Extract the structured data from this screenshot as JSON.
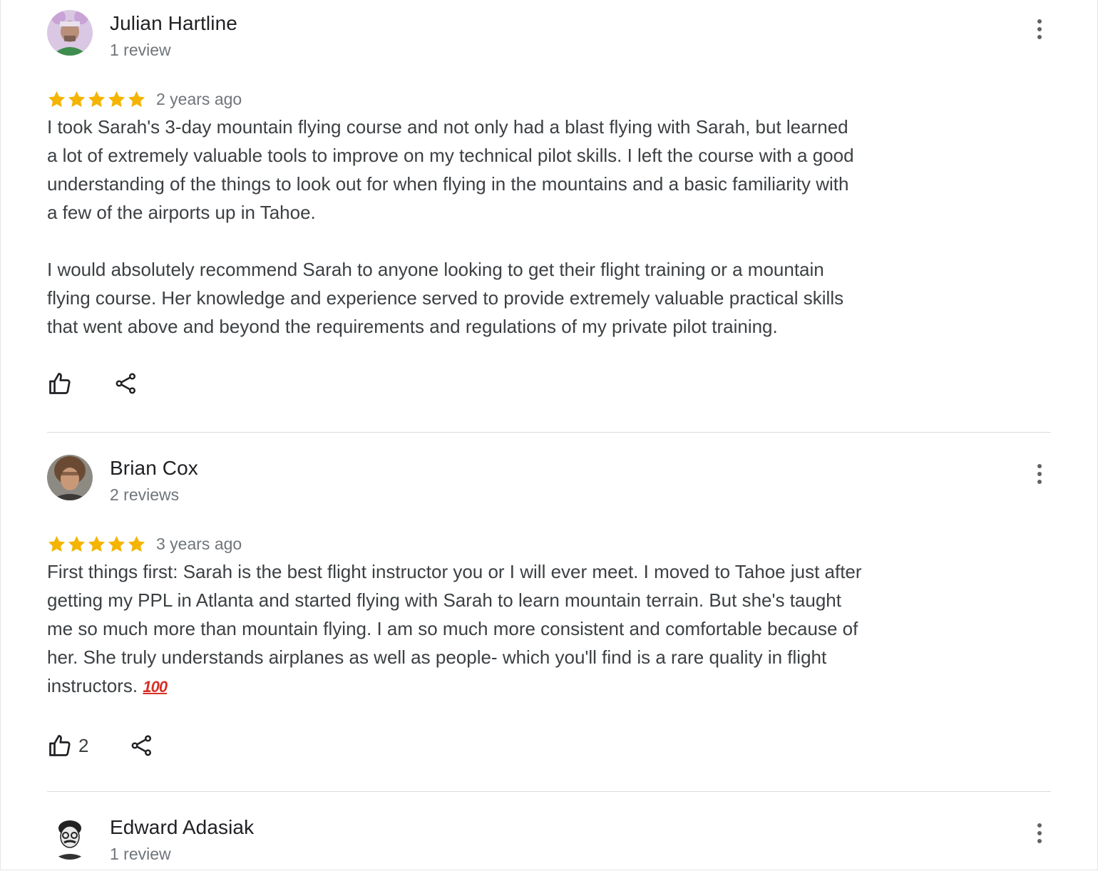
{
  "reviews": [
    {
      "name": "Julian Hartline",
      "review_count": "1 review",
      "rating": 5,
      "date": "2 years ago",
      "body": "I took Sarah's 3-day mountain flying course and not only had a blast flying with Sarah, but learned\na lot of extremely valuable tools to improve on my technical pilot skills. I left the course with a good\nunderstanding of the things to look out for when flying in the mountains and a basic familiarity with\na few of the airports up in Tahoe.\n\nI would absolutely recommend Sarah to anyone looking to get their flight training or a mountain\nflying course. Her knowledge and experience served to provide extremely valuable practical skills\nthat went above and beyond the requirements and regulations of my private pilot training.",
      "likes": ""
    },
    {
      "name": "Brian Cox",
      "review_count": "2 reviews",
      "rating": 5,
      "date": "3 years ago",
      "body": "First things first: Sarah is the best flight instructor you or I will ever meet. I moved to Tahoe just after\ngetting my PPL in Atlanta and started flying with Sarah to learn mountain terrain. But she's taught\nme so much more than mountain flying. I am so much more consistent and comfortable because of\nher. She truly understands airplanes as well as people- which you'll find is a rare quality in flight\ninstructors. ",
      "body_emoji": "100",
      "likes": "2"
    },
    {
      "name": "Edward Adasiak",
      "review_count": "1 review"
    }
  ],
  "colors": {
    "star": "#f4b400",
    "name": "#202124",
    "meta": "#70757a",
    "text": "#3c4043",
    "divider": "#dadce0"
  },
  "icons": {
    "more": "more-vert-icon",
    "like": "thumb-up-icon",
    "share": "share-icon",
    "star": "star-icon",
    "emoji": "hundred-points-emoji"
  }
}
